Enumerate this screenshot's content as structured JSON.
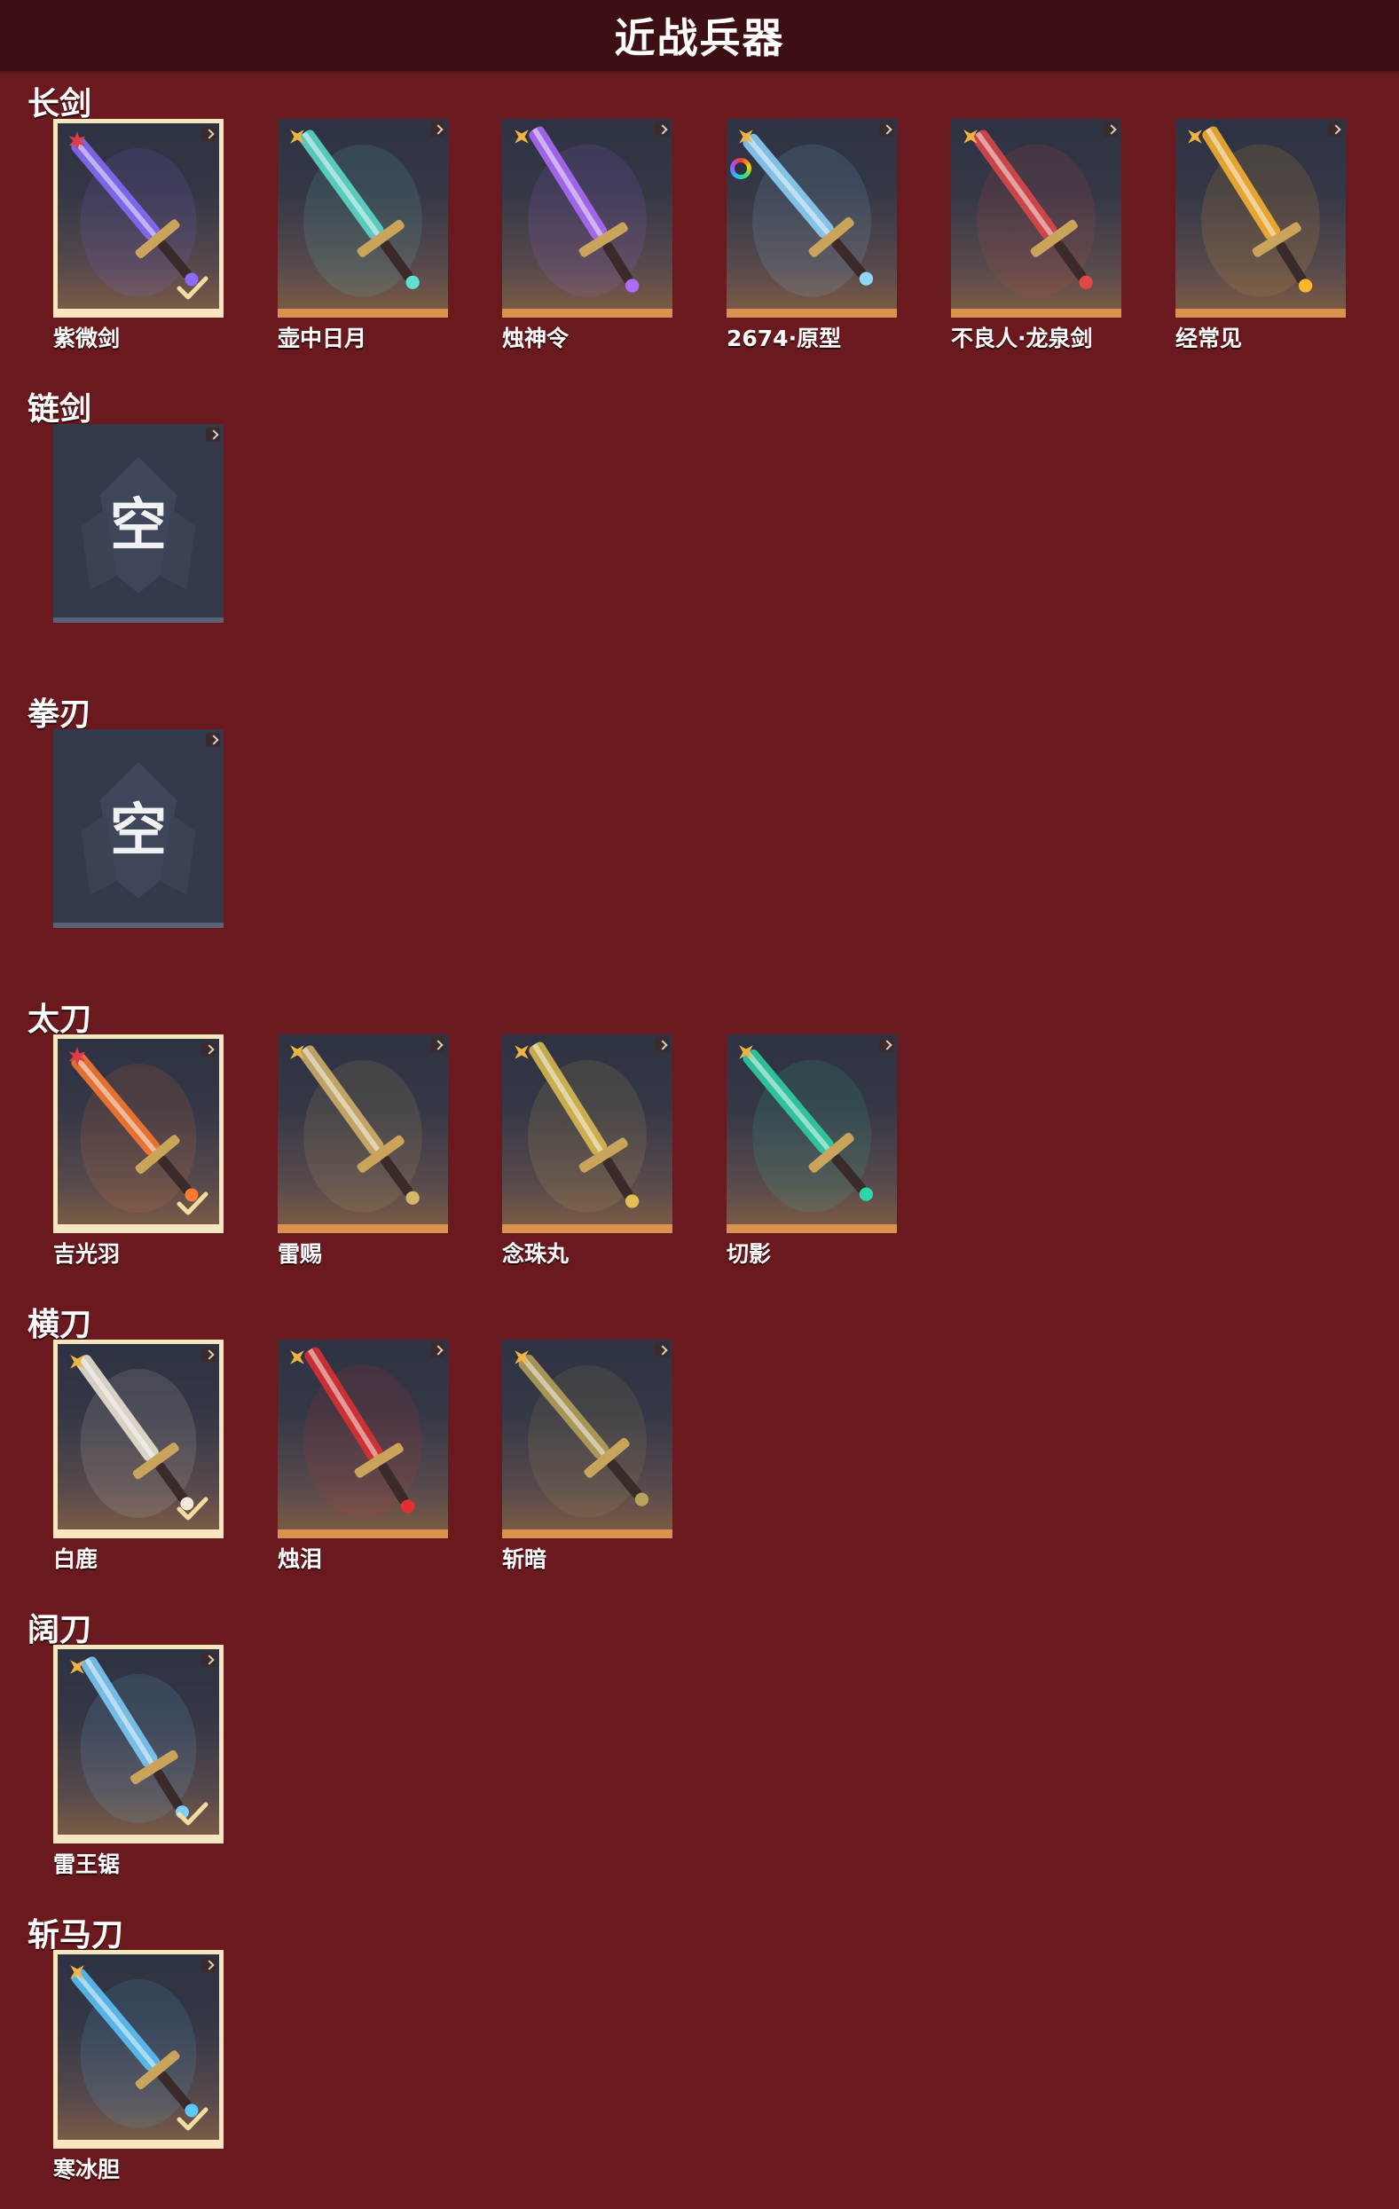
{
  "title": "近战兵器",
  "empty_text": "空",
  "colors": {
    "background": "#6a1a1e",
    "header_background": "#3d0f12",
    "selected_border": "#f6e6bf",
    "card_bottom_bar": "#d9924f",
    "empty_slot": "#323a4b",
    "legendary_rank_icon": "#e03a4a",
    "standard_rank_icon": "#f0b540"
  },
  "sections": [
    {
      "category": "长剑",
      "weapons": [
        {
          "name": "紫微剑",
          "selected": true,
          "rank_icon": "star-rank-icon",
          "accent": "#8a6cff"
        },
        {
          "name": "壶中日月",
          "selected": false,
          "rank_icon": "diamond-rank-icon",
          "accent": "#5fe0d0"
        },
        {
          "name": "烛神令",
          "selected": false,
          "rank_icon": "diamond-rank-icon",
          "accent": "#b06cff"
        },
        {
          "name": "2674·原型",
          "selected": false,
          "rank_icon": "diamond-rank-icon",
          "extra_icon": "rainbow-ring-icon",
          "accent": "#8fd6ff"
        },
        {
          "name": "不良人·龙泉剑",
          "selected": false,
          "rank_icon": "diamond-rank-icon",
          "accent": "#e04848"
        },
        {
          "name": "经常见",
          "selected": false,
          "rank_icon": "diamond-rank-icon",
          "accent": "#ffb52e"
        }
      ]
    },
    {
      "category": "链剑",
      "weapons": [
        {
          "empty": true
        }
      ]
    },
    {
      "category": "拳刃",
      "weapons": [
        {
          "empty": true
        }
      ]
    },
    {
      "category": "太刀",
      "weapons": [
        {
          "name": "吉光羽",
          "selected": true,
          "rank_icon": "star-rank-icon",
          "accent": "#ff7a2e"
        },
        {
          "name": "雷赐",
          "selected": false,
          "rank_icon": "diamond-rank-icon",
          "accent": "#d6b56a"
        },
        {
          "name": "念珠丸",
          "selected": false,
          "rank_icon": "diamond-rank-icon",
          "accent": "#e0c050"
        },
        {
          "name": "切影",
          "selected": false,
          "rank_icon": "diamond-rank-icon",
          "accent": "#2ed6a8"
        }
      ]
    },
    {
      "category": "横刀",
      "weapons": [
        {
          "name": "白鹿",
          "selected": true,
          "rank_icon": "diamond-rank-icon",
          "accent": "#f2ead8"
        },
        {
          "name": "烛泪",
          "selected": false,
          "rank_icon": "diamond-rank-icon",
          "accent": "#e03030"
        },
        {
          "name": "斩暗",
          "selected": false,
          "rank_icon": "diamond-rank-icon",
          "accent": "#b8a35a"
        }
      ]
    },
    {
      "category": "阔刀",
      "weapons": [
        {
          "name": "雷王锯",
          "selected": true,
          "rank_icon": "diamond-rank-icon",
          "accent": "#7fd0ff"
        }
      ]
    },
    {
      "category": "斩马刀",
      "weapons": [
        {
          "name": "寒冰胆",
          "selected": true,
          "rank_icon": "diamond-rank-icon",
          "accent": "#5cc8ff"
        }
      ]
    }
  ]
}
